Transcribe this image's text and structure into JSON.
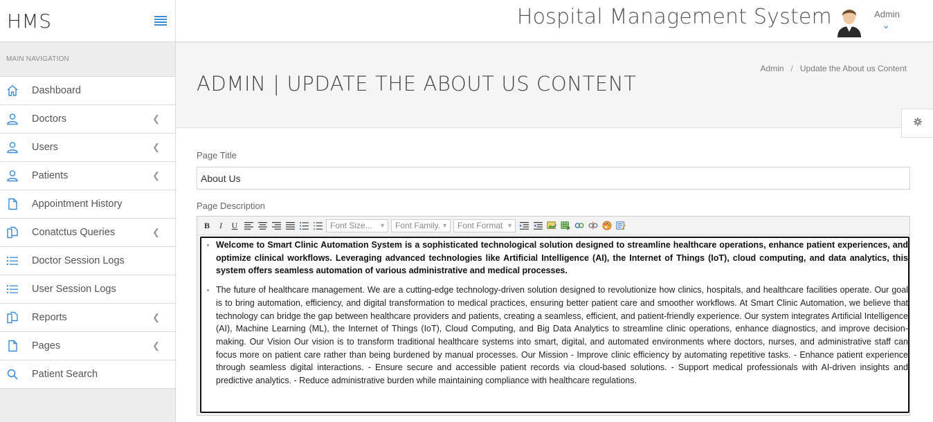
{
  "brand": {
    "name": "HMS"
  },
  "header": {
    "app_title": "Hospital Management System",
    "user_name": "Admin"
  },
  "sidebar": {
    "section_label": "MAIN NAVIGATION",
    "items": [
      {
        "label": "Dashboard",
        "icon": "home-icon",
        "has_submenu": false
      },
      {
        "label": "Doctors",
        "icon": "user-icon",
        "has_submenu": true
      },
      {
        "label": "Users",
        "icon": "user-icon",
        "has_submenu": true
      },
      {
        "label": "Patients",
        "icon": "user-icon",
        "has_submenu": true
      },
      {
        "label": "Appointment History",
        "icon": "file-icon",
        "has_submenu": false
      },
      {
        "label": "Conatctus Queries",
        "icon": "files-icon",
        "has_submenu": true
      },
      {
        "label": "Doctor Session Logs",
        "icon": "list-icon",
        "has_submenu": false
      },
      {
        "label": "User Session Logs",
        "icon": "list-icon",
        "has_submenu": false
      },
      {
        "label": "Reports",
        "icon": "files-icon",
        "has_submenu": true
      },
      {
        "label": "Pages",
        "icon": "file-icon",
        "has_submenu": true
      },
      {
        "label": "Patient Search",
        "icon": "search-icon",
        "has_submenu": false
      }
    ]
  },
  "page": {
    "title": "ADMIN | UPDATE THE ABOUT US CONTENT",
    "breadcrumb": [
      "Admin",
      "Update the About us Content"
    ]
  },
  "form": {
    "title_label": "Page Title",
    "title_value": "About Us",
    "description_label": "Page Description",
    "toolbar": {
      "bold": "B",
      "italic": "I",
      "underline": "U",
      "font_size": "Font Size...",
      "font_family": "Font Family.",
      "font_format": "Font Format"
    },
    "content": {
      "paragraph_1": "Welcome to Smart Clinic Automation System is a sophisticated technological solution designed to streamline healthcare operations, enhance patient experiences, and optimize clinical workflows. Leveraging advanced technologies like Artificial Intelligence (AI), the Internet of Things (IoT), cloud computing, and data analytics, this system offers seamless automation of various administrative and medical processes.",
      "paragraph_2": "The future of healthcare management. We are a cutting-edge technology-driven solution designed to revolutionize how clinics, hospitals, and healthcare facilities operate. Our goal is to bring automation, efficiency, and digital transformation to medical practices, ensuring better patient care and smoother workflows. At Smart Clinic Automation, we believe that technology can bridge the gap between healthcare providers and patients, creating a seamless, efficient, and patient-friendly experience. Our system integrates Artificial Intelligence (AI), Machine Learning (ML), the Internet of Things (IoT), Cloud Computing, and Big Data Analytics to streamline clinic operations, enhance diagnostics, and improve decision-making. Our Vision Our vision is to transform traditional healthcare systems into smart, digital, and automated environments where doctors, nurses, and administrative staff can focus more on patient care rather than being burdened by manual processes. Our Mission - Improve clinic efficiency by automating repetitive tasks. - Enhance patient experience through seamless digital interactions. - Ensure secure and accessible patient records via cloud-based solutions. - Support medical professionals with AI-driven insights and predictive analytics. - Reduce administrative burden while maintaining compliance with healthcare regulations."
    }
  },
  "colors": {
    "accent": "#3a8ad6",
    "sidebar_bg": "#ededed",
    "page_head_bg": "#f5f5f5"
  }
}
